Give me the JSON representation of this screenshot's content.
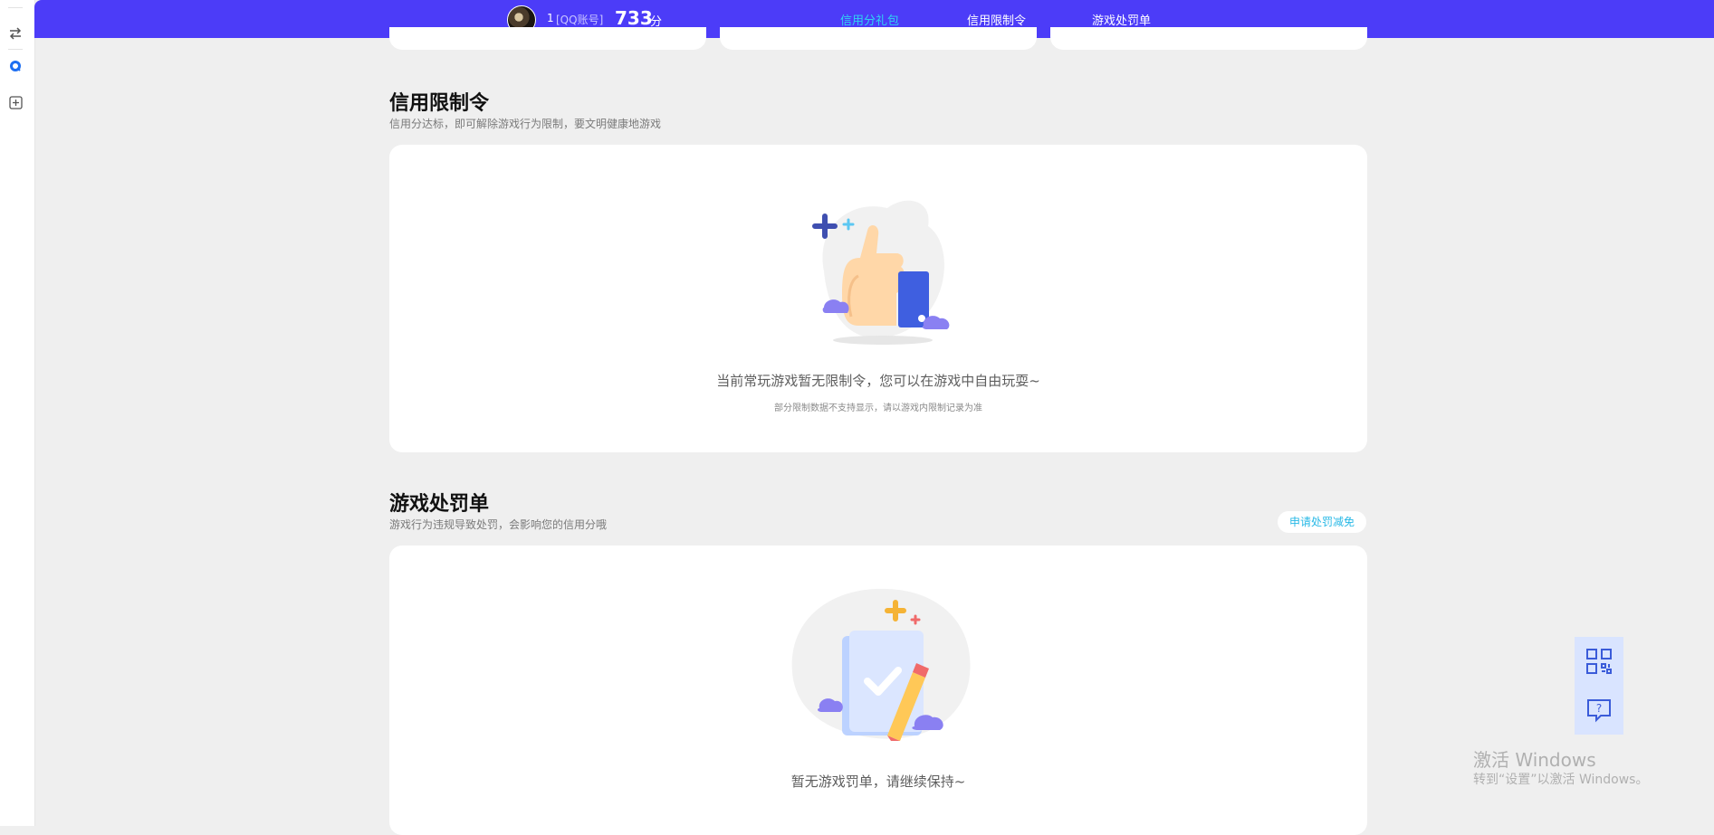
{
  "header": {
    "username": "1",
    "account_type": "[QQ账号]",
    "score": "733",
    "score_unit": "分",
    "tabs": [
      {
        "label": "信用分礼包",
        "active": true
      },
      {
        "label": "信用限制令",
        "active": false
      },
      {
        "label": "游戏处罚单",
        "active": false
      }
    ]
  },
  "restriction": {
    "title": "信用限制令",
    "subtitle": "信用分达标，即可解除游戏行为限制，要文明健康地游戏",
    "empty_text": "当前常玩游戏暂无限制令，您可以在游戏中自由玩耍~",
    "empty_note": "部分限制数据不支持显示，请以游戏内限制记录为准"
  },
  "penalty": {
    "title": "游戏处罚单",
    "subtitle": "游戏行为违规导致处罚，会影响您的信用分哦",
    "apply_button": "申请处罚减免",
    "empty_text": "暂无游戏罚单，请继续保持~"
  },
  "watermark": {
    "line1": "激活 Windows",
    "line2": "转到“设置”以激活 Windows。"
  },
  "colors": {
    "header_bg": "#4c3cf8",
    "active_tab": "#2fd4f2",
    "page_bg": "#efefef",
    "link": "#27b8e6"
  },
  "icons": [
    "swap-icon",
    "qq-icon",
    "add-box-icon",
    "qr-code-icon",
    "help-chat-icon"
  ]
}
